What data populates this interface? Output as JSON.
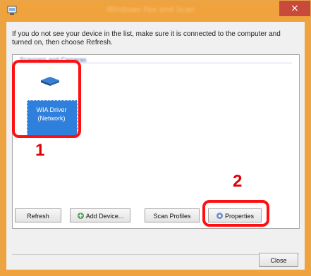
{
  "window": {
    "title": "Windows Fax and Scan",
    "close_glyph": "×"
  },
  "dialog": {
    "instruction": "If you do not see your device in the list, make sure it is connected to the computer and turned on, then choose Refresh.",
    "group_header": "Scanners and Cameras",
    "device": {
      "label_line1": "WIA Driver",
      "label_line2": "(Network)",
      "icon": "scanner-icon"
    },
    "callouts": [
      "1",
      "2"
    ],
    "buttons": {
      "refresh": "Refresh",
      "add_device": "Add Device...",
      "scan_profiles": "Scan Profiles",
      "properties": "Properties",
      "close": "Close"
    }
  },
  "colors": {
    "titlebar": "#f0a23c",
    "highlight": "#ff1010",
    "selection": "#2f7fdc"
  }
}
